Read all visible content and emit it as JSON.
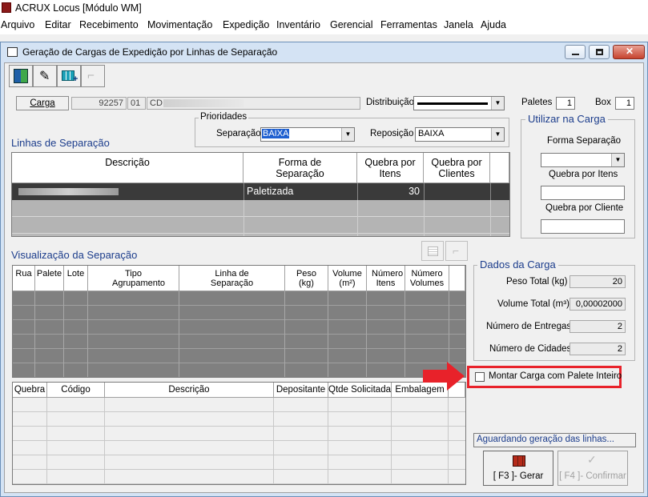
{
  "app": {
    "title": "ACRUX Locus [Módulo WM]"
  },
  "menu": [
    "Arquivo",
    "Editar",
    "Recebimento",
    "Movimentação",
    "Expedição",
    "Inventário",
    "Gerencial",
    "Ferramentas",
    "Janela",
    "Ajuda"
  ],
  "window": {
    "title": "Geração de Cargas de Expedição por Linhas de Separação"
  },
  "header": {
    "carga_button": "Carga",
    "carga_number": "92257",
    "carga_seq": "01",
    "carga_prefix": "CD",
    "distribuicao_label": "Distribuição",
    "paletes_label": "Paletes",
    "paletes_value": "1",
    "box_label": "Box",
    "box_value": "1"
  },
  "prioridades": {
    "title": "Prioridades",
    "separacao_label": "Separação",
    "separacao_value": "BAIXA",
    "reposicao_label": "Reposição",
    "reposicao_value": "BAIXA"
  },
  "linhas": {
    "title": "Linhas de Separação",
    "columns": [
      "Descrição",
      "Forma de Separação",
      "Quebra por Itens",
      "Quebra por Clientes"
    ],
    "row": {
      "forma": "Paletizada",
      "quebra_itens": "30"
    }
  },
  "utilizar": {
    "title": "Utilizar na Carga",
    "forma_label": "Forma Separação",
    "quebra_itens_label": "Quebra por Itens",
    "quebra_clientes_label": "Quebra por Cliente"
  },
  "visualizacao": {
    "title": "Visualização da Separação",
    "columns": [
      "Rua",
      "Palete",
      "Lote",
      "Tipo Agrupamento",
      "Linha de Separação",
      "Peso (kg)",
      "Volume (m²)",
      "Número Itens",
      "Número Volumes"
    ]
  },
  "detalhe": {
    "columns": [
      "Quebra",
      "Código",
      "Descrição",
      "Depositante",
      "Qtde Solicitada",
      "Embalagem"
    ]
  },
  "dados": {
    "title": "Dados da Carga",
    "peso_label": "Peso Total (kg)",
    "peso_value": "20",
    "volume_label": "Volume Total (m³)",
    "volume_value": "0,00002000",
    "entregas_label": "Número de Entregas",
    "entregas_value": "2",
    "cidades_label": "Número de Cidades",
    "cidades_value": "2"
  },
  "montar": {
    "label": "Montar Carga com Palete Inteiro"
  },
  "status": {
    "text": "Aguardando geração das linhas..."
  },
  "actions": {
    "gerar": "[ F3 ]- Gerar",
    "confirmar": "[ F4 ]- Confirmar"
  },
  "colors": {
    "highlight": "#e8222a",
    "section_title": "#1c3d8c",
    "selected_row": "#3a3a3a"
  }
}
